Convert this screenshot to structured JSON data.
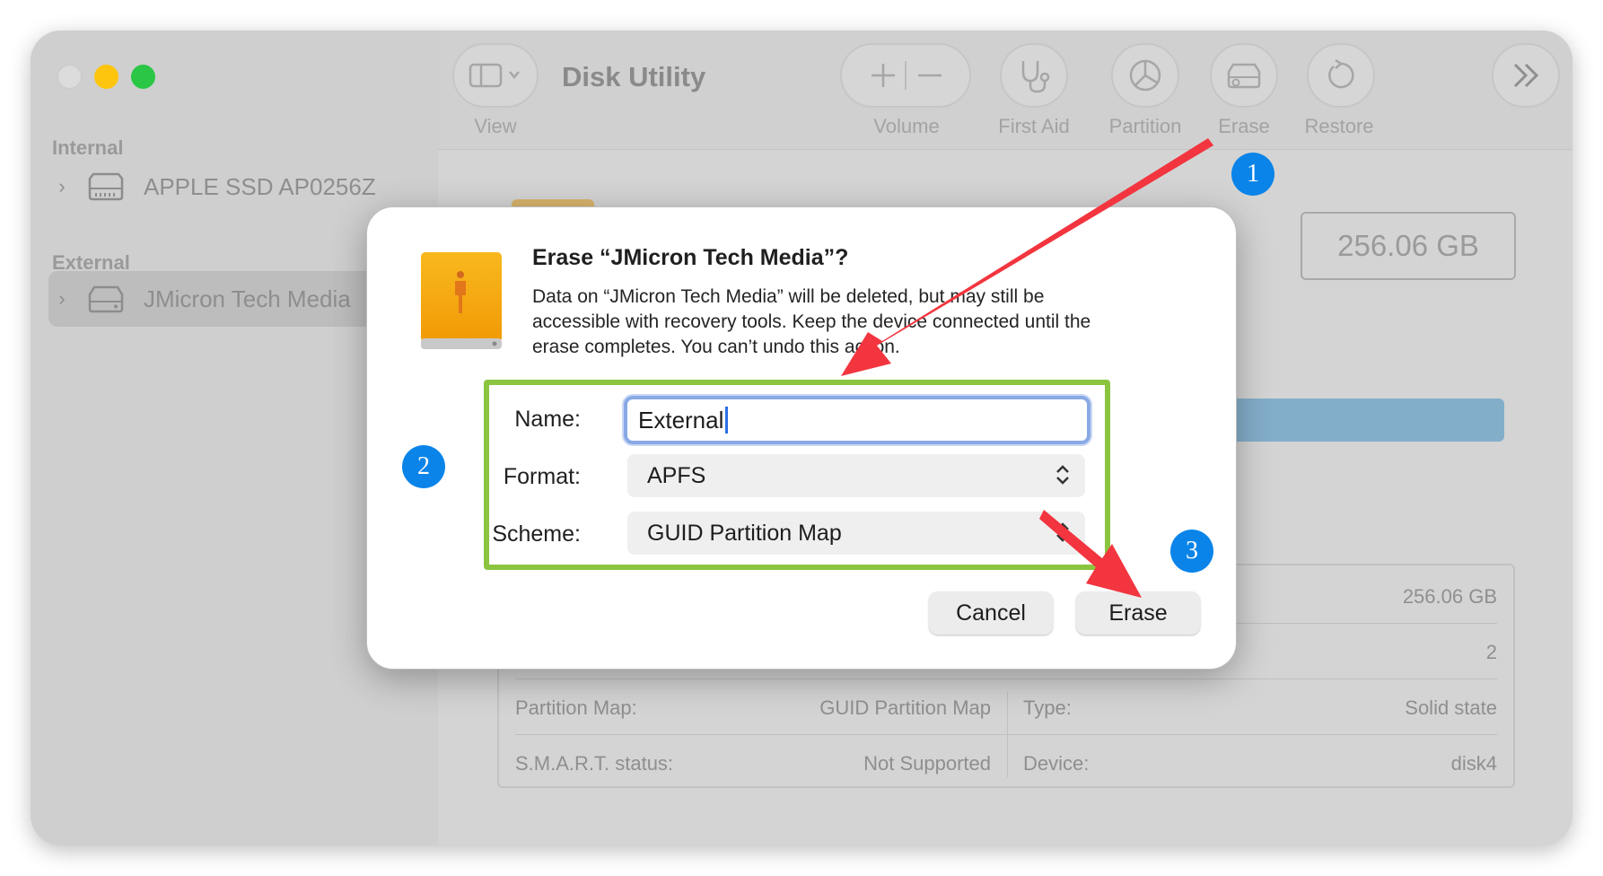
{
  "window": {
    "title": "Disk Utility"
  },
  "toolbar": {
    "view_label": "View",
    "volume_label": "Volume",
    "first_aid_label": "First Aid",
    "partition_label": "Partition",
    "erase_label": "Erase",
    "restore_label": "Restore"
  },
  "sidebar": {
    "internal_heading": "Internal",
    "internal_item": "APPLE SSD AP0256Z",
    "external_heading": "External",
    "external_item": "JMicron Tech Media"
  },
  "main": {
    "capacity": "256.06 GB",
    "info": {
      "left": [
        {
          "label": "Partition Map:",
          "value": "GUID Partition Map"
        },
        {
          "label": "S.M.A.R.T. status:",
          "value": "Not Supported"
        }
      ],
      "right_top": [
        "256.06 GB",
        "2"
      ],
      "right": [
        {
          "label": "Type:",
          "value": "Solid state"
        },
        {
          "label": "Device:",
          "value": "disk4"
        }
      ]
    }
  },
  "dialog": {
    "title": "Erase “JMicron Tech Media”?",
    "message_lines": [
      "Data on “JMicron Tech Media” will be deleted, but may still be",
      "accessible with recovery tools. Keep the device connected until the",
      "erase completes. You can’t undo this action."
    ],
    "name_label": "Name:",
    "name_value": "External",
    "format_label": "Format:",
    "format_value": "APFS",
    "scheme_label": "Scheme:",
    "scheme_value": "GUID Partition Map",
    "cancel_label": "Cancel",
    "erase_label": "Erase"
  },
  "annotations": {
    "badge_1": "1",
    "badge_2": "2",
    "badge_3": "3"
  },
  "colors": {
    "traffic_close": "#e3e3e3",
    "traffic_minimize": "#fdc50d",
    "traffic_zoom": "#2ac646",
    "highlight_box": "#8bc53f",
    "arrow": "#f2353f",
    "badge": "#0a84e8",
    "drive_icon": "#f5a50f"
  }
}
